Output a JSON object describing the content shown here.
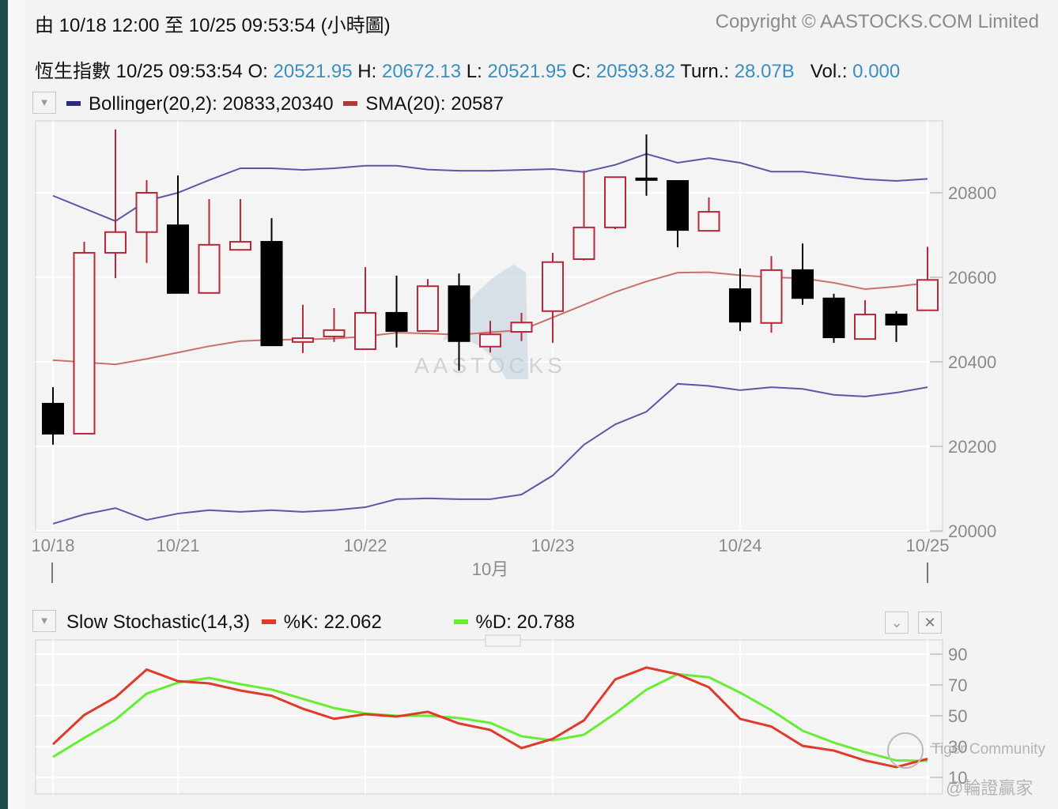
{
  "header": {
    "range_text": "由  10/18 12:00 至  10/25 09:53:54 (小時圖)",
    "copyright": "Copyright © AASTOCKS.COM Limited"
  },
  "quote": {
    "name": "恆生指數",
    "time": "10/25 09:53:54",
    "open_label": "O:",
    "open": "20521.95",
    "high_label": "H:",
    "high": "20672.13",
    "low_label": "L:",
    "low": "20521.95",
    "close_label": "C:",
    "close": "20593.82",
    "turnover_label": "Turn.:",
    "turnover": "28.07B",
    "volume_label": "Vol.:",
    "volume": "0.000"
  },
  "main_legend": {
    "bollinger": "Bollinger(20,2): 20833,20340",
    "sma": "SMA(20): 20587"
  },
  "stoch_legend": {
    "title": "Slow Stochastic(14,3)",
    "k": "%K: 22.062",
    "d": "%D: 20.788"
  },
  "watermark": {
    "logo_text": "AASTOCKS",
    "tiger": "Tiger Community",
    "user": "@輪證贏家"
  },
  "colors": {
    "bollinger": "#2e2a7a",
    "bollinger_line": "#5b58a8",
    "sma": "#b03a3a",
    "sma_line": "#c8706a",
    "up": "#b8283a",
    "down": "#000000",
    "k": "#e03a2a",
    "d": "#66ee33",
    "value": "#3a8fc0"
  },
  "chart_data": [
    {
      "type": "candlestick",
      "title": "",
      "ylim": [
        20000,
        20950
      ],
      "yticks": [
        20000,
        20200,
        20400,
        20600,
        20800
      ],
      "xtick_labels": [
        {
          "index": 0,
          "label": "10/18"
        },
        {
          "index": 4,
          "label": "10/21"
        },
        {
          "index": 10,
          "label": "10/22"
        },
        {
          "index": 16,
          "label": "10/23"
        },
        {
          "index": 22,
          "label": "10/24"
        },
        {
          "index": 28,
          "label": "10/25"
        }
      ],
      "month_label": "10月",
      "grid": true,
      "ohlc": [
        [
          20301,
          20340,
          20204,
          20230
        ],
        [
          20230,
          20684,
          20230,
          20658
        ],
        [
          20658,
          20950,
          20598,
          20707
        ],
        [
          20707,
          20830,
          20634,
          20800
        ],
        [
          20723,
          20841,
          20563,
          20563
        ],
        [
          20563,
          20785,
          20563,
          20677
        ],
        [
          20665,
          20785,
          20665,
          20684
        ],
        [
          20684,
          20740,
          20439,
          20439
        ],
        [
          20447,
          20535,
          20421,
          20456
        ],
        [
          20460,
          20527,
          20447,
          20475
        ],
        [
          20430,
          20624,
          20430,
          20516
        ],
        [
          20516,
          20604,
          20434,
          20473
        ],
        [
          20473,
          20596,
          20473,
          20579
        ],
        [
          20579,
          20609,
          20379,
          20449
        ],
        [
          20436,
          20497,
          20422,
          20465
        ],
        [
          20471,
          20516,
          20449,
          20493
        ],
        [
          20520,
          20658,
          20445,
          20636
        ],
        [
          20643,
          20852,
          20640,
          20718
        ],
        [
          20718,
          20837,
          20714,
          20837
        ],
        [
          20834,
          20938,
          20793,
          20832
        ],
        [
          20828,
          20828,
          20671,
          20712
        ],
        [
          20710,
          20789,
          20710,
          20755
        ],
        [
          20572,
          20621,
          20473,
          20495
        ],
        [
          20492,
          20650,
          20469,
          20617
        ],
        [
          20617,
          20680,
          20535,
          20551
        ],
        [
          20550,
          20561,
          20445,
          20458
        ],
        [
          20454,
          20546,
          20454,
          20512
        ],
        [
          20512,
          20520,
          20447,
          20488
        ],
        [
          20521.95,
          20672.13,
          20521.95,
          20593.82
        ]
      ],
      "series": [
        {
          "name": "Bollinger(20,2)",
          "values_upper": [
            20793,
            20763,
            20733,
            20781,
            20800,
            20830,
            20858,
            20858,
            20854,
            20858,
            20864,
            20864,
            20855,
            20852,
            20852,
            20854,
            20856,
            20849,
            20866,
            20892,
            20871,
            20882,
            20871,
            20850,
            20850,
            20841,
            20832,
            20828,
            20833
          ],
          "values_lower": [
            20017,
            20039,
            20054,
            20026,
            20041,
            20049,
            20045,
            20049,
            20045,
            20049,
            20056,
            20075,
            20077,
            20075,
            20075,
            20086,
            20131,
            20204,
            20252,
            20282,
            20348,
            20343,
            20333,
            20340,
            20336,
            20322,
            20318,
            20327,
            20340
          ]
        },
        {
          "name": "SMA(20)",
          "values": [
            20404,
            20399,
            20394,
            20407,
            20422,
            20437,
            20449,
            20452,
            20453,
            20455,
            20460,
            20469,
            20467,
            20464,
            20470,
            20475,
            20505,
            20535,
            20565,
            20590,
            20611,
            20612,
            20605,
            20600,
            20598,
            20587,
            20572,
            20578,
            20587
          ]
        }
      ]
    },
    {
      "type": "line",
      "title": "Slow Stochastic(14,3)",
      "ylim": [
        5,
        100
      ],
      "yticks": [
        10,
        30,
        50,
        70,
        90
      ],
      "grid": true,
      "series": [
        {
          "name": "%K",
          "values": [
            31.5,
            50.5,
            62,
            80,
            72.5,
            71,
            66.4,
            63,
            54.6,
            48,
            51,
            49.5,
            52.6,
            45,
            40.8,
            29,
            35,
            47,
            73.6,
            81.3,
            77,
            68.5,
            48,
            43,
            30.5,
            27.4,
            21,
            16.7,
            22.1
          ]
        },
        {
          "name": "%D",
          "values": [
            23.3,
            35.6,
            47.4,
            64.4,
            71.5,
            74.6,
            70.5,
            67,
            61,
            55,
            51.5,
            50,
            50,
            48.5,
            45.4,
            36.7,
            34,
            37.7,
            51.5,
            67,
            77,
            75,
            65,
            53.6,
            40.3,
            32.6,
            26.4,
            21,
            20.8
          ]
        }
      ]
    }
  ]
}
